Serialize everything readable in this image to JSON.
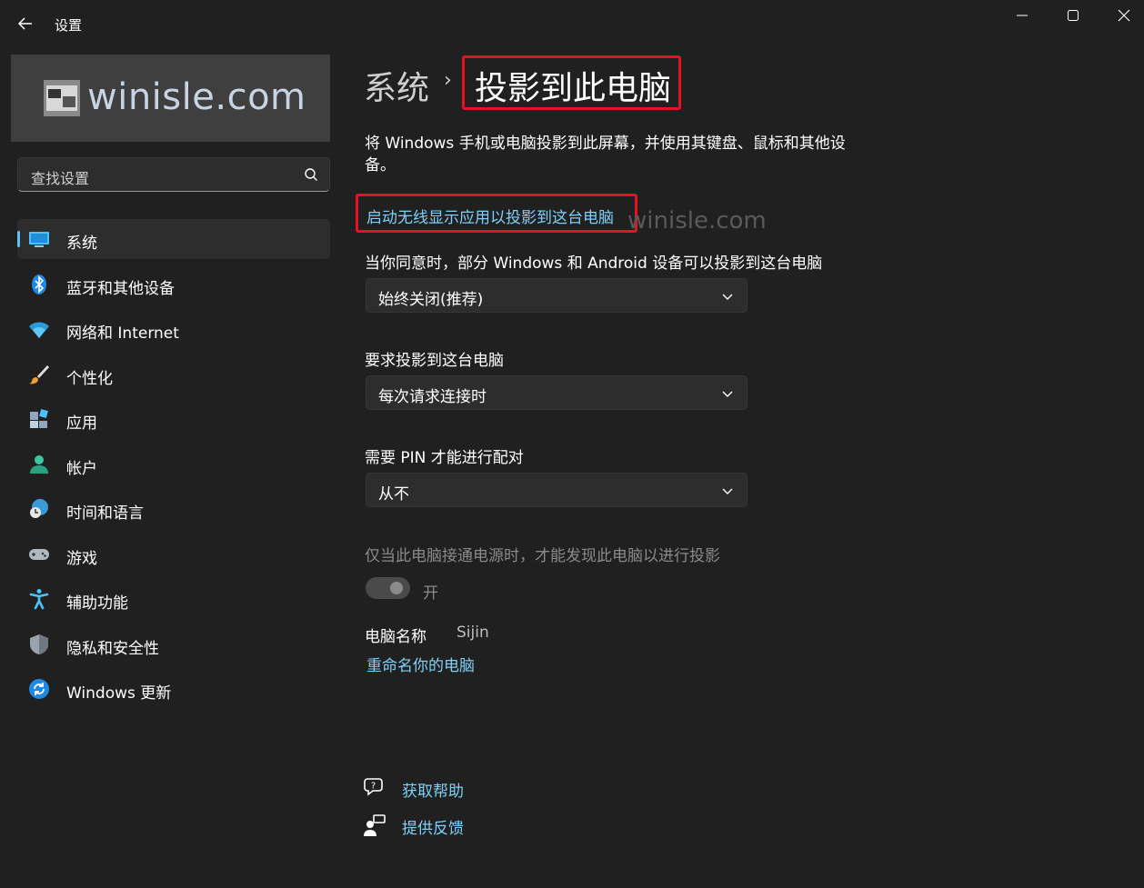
{
  "window": {
    "title": "设置"
  },
  "sidebar": {
    "banner_text": "winisle.com",
    "search_placeholder": "查找设置",
    "items": [
      {
        "label": "系统",
        "icon": "display-icon",
        "active": true
      },
      {
        "label": "蓝牙和其他设备",
        "icon": "bluetooth-icon"
      },
      {
        "label": "网络和 Internet",
        "icon": "wifi-icon"
      },
      {
        "label": "个性化",
        "icon": "brush-icon"
      },
      {
        "label": "应用",
        "icon": "apps-icon"
      },
      {
        "label": "帐户",
        "icon": "account-icon"
      },
      {
        "label": "时间和语言",
        "icon": "globe-clock-icon"
      },
      {
        "label": "游戏",
        "icon": "gamepad-icon"
      },
      {
        "label": "辅助功能",
        "icon": "accessibility-icon"
      },
      {
        "label": "隐私和安全性",
        "icon": "shield-icon"
      },
      {
        "label": "Windows 更新",
        "icon": "update-icon"
      }
    ]
  },
  "main": {
    "breadcrumb_parent": "系统",
    "breadcrumb_sep": "›",
    "page_title": "投影到此电脑",
    "description": "将 Windows 手机或电脑投影到此屏幕，并使用其键盘、鼠标和其他设备。",
    "launch_link": "启动无线显示应用以投影到这台电脑",
    "watermark": "winisle.com",
    "settings": [
      {
        "label": "当你同意时，部分 Windows 和 Android 设备可以投影到这台电脑",
        "value": "始终关闭(推荐)"
      },
      {
        "label": "要求投影到这台电脑",
        "value": "每次请求连接时"
      },
      {
        "label": "需要 PIN 才能进行配对",
        "value": "从不"
      }
    ],
    "power_label": "仅当此电脑接通电源时，才能发现此电脑以进行投影",
    "power_toggle_label": "开",
    "pc_name_label": "电脑名称",
    "pc_name_value": "Sijin",
    "rename_link": "重命名你的电脑",
    "help_link": "获取帮助",
    "feedback_link": "提供反馈"
  },
  "colors": {
    "accent": "#5ec2f1",
    "link": "#7fd0f8",
    "highlight": "#e81123",
    "background": "#202020"
  }
}
